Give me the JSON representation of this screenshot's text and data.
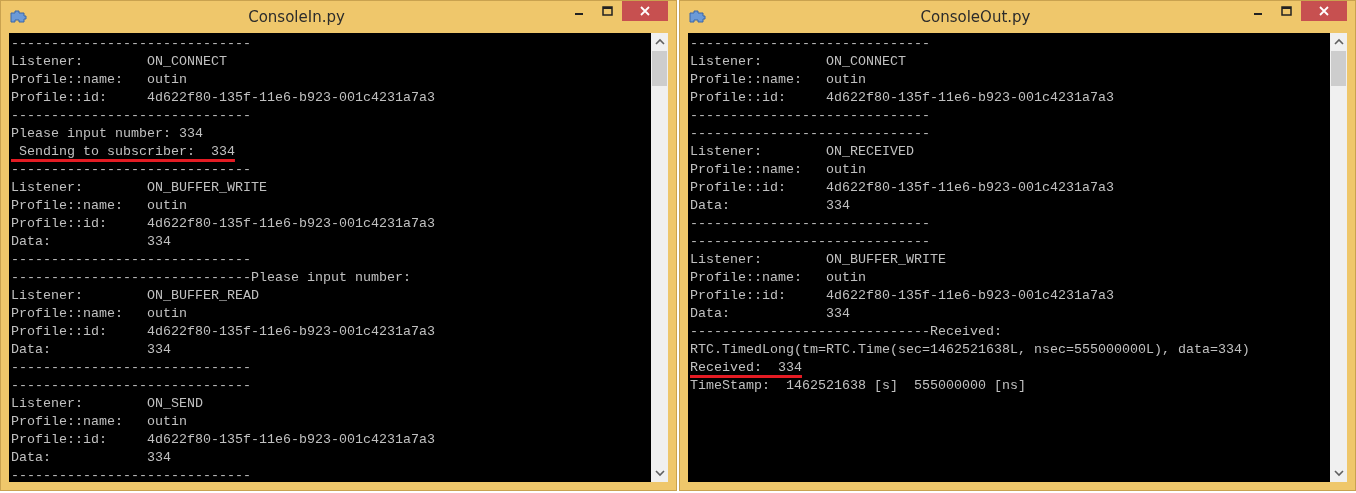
{
  "windows": [
    {
      "title": "ConsoleIn.py",
      "lines": [
        {
          "text": "------------------------------",
          "underlined": false
        },
        {
          "text": "Listener:        ON_CONNECT",
          "underlined": false
        },
        {
          "text": "Profile::name:   outin",
          "underlined": false
        },
        {
          "text": "Profile::id:     4d622f80-135f-11e6-b923-001c4231a7a3",
          "underlined": false
        },
        {
          "text": "------------------------------",
          "underlined": false
        },
        {
          "text": "Please input number: 334",
          "underlined": false
        },
        {
          "text": " Sending to subscriber:  334",
          "underlined": true
        },
        {
          "text": "------------------------------",
          "underlined": false
        },
        {
          "text": "Listener:        ON_BUFFER_WRITE",
          "underlined": false
        },
        {
          "text": "Profile::name:   outin",
          "underlined": false
        },
        {
          "text": "Profile::id:     4d622f80-135f-11e6-b923-001c4231a7a3",
          "underlined": false
        },
        {
          "text": "Data:            334",
          "underlined": false
        },
        {
          "text": "------------------------------",
          "underlined": false
        },
        {
          "text": "------------------------------Please input number:",
          "underlined": false
        },
        {
          "text": "Listener:        ON_BUFFER_READ",
          "underlined": false
        },
        {
          "text": "Profile::name:   outin",
          "underlined": false
        },
        {
          "text": "Profile::id:     4d622f80-135f-11e6-b923-001c4231a7a3",
          "underlined": false
        },
        {
          "text": "Data:            334",
          "underlined": false
        },
        {
          "text": "------------------------------",
          "underlined": false
        },
        {
          "text": "------------------------------",
          "underlined": false
        },
        {
          "text": "Listener:        ON_SEND",
          "underlined": false
        },
        {
          "text": "Profile::name:   outin",
          "underlined": false
        },
        {
          "text": "Profile::id:     4d622f80-135f-11e6-b923-001c4231a7a3",
          "underlined": false
        },
        {
          "text": "Data:            334",
          "underlined": false
        },
        {
          "text": "------------------------------",
          "underlined": false
        }
      ]
    },
    {
      "title": "ConsoleOut.py",
      "lines": [
        {
          "text": "------------------------------",
          "underlined": false
        },
        {
          "text": "Listener:        ON_CONNECT",
          "underlined": false
        },
        {
          "text": "Profile::name:   outin",
          "underlined": false
        },
        {
          "text": "Profile::id:     4d622f80-135f-11e6-b923-001c4231a7a3",
          "underlined": false
        },
        {
          "text": "------------------------------",
          "underlined": false
        },
        {
          "text": "------------------------------",
          "underlined": false
        },
        {
          "text": "Listener:        ON_RECEIVED",
          "underlined": false
        },
        {
          "text": "Profile::name:   outin",
          "underlined": false
        },
        {
          "text": "Profile::id:     4d622f80-135f-11e6-b923-001c4231a7a3",
          "underlined": false
        },
        {
          "text": "Data:            334",
          "underlined": false
        },
        {
          "text": "------------------------------",
          "underlined": false
        },
        {
          "text": "------------------------------",
          "underlined": false
        },
        {
          "text": "Listener:        ON_BUFFER_WRITE",
          "underlined": false
        },
        {
          "text": "Profile::name:   outin",
          "underlined": false
        },
        {
          "text": "Profile::id:     4d622f80-135f-11e6-b923-001c4231a7a3",
          "underlined": false
        },
        {
          "text": "Data:            334",
          "underlined": false
        },
        {
          "text": "------------------------------Received:",
          "underlined": false
        },
        {
          "text": "RTC.TimedLong(tm=RTC.Time(sec=1462521638L, nsec=555000000L), data=334)",
          "underlined": false
        },
        {
          "text": "Received:  334",
          "underlined": true
        },
        {
          "text": "TimeStamp:  1462521638 [s]  555000000 [ns]",
          "underlined": false
        }
      ]
    }
  ]
}
